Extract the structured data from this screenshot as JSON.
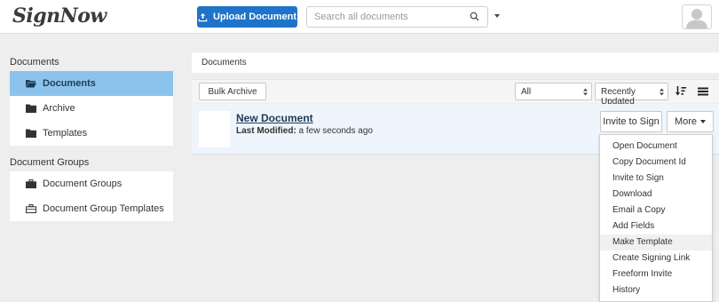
{
  "header": {
    "logo": "SignNow",
    "upload_label": "Upload Document",
    "search_placeholder": "Search all documents"
  },
  "sidebar": {
    "documents_title": "Documents",
    "documents_items": [
      {
        "label": "Documents",
        "icon": "open-folder-icon",
        "active": true
      },
      {
        "label": "Archive",
        "icon": "folder-icon"
      },
      {
        "label": "Templates",
        "icon": "folder-icon"
      }
    ],
    "groups_title": "Document Groups",
    "groups_items": [
      {
        "label": "Document Groups",
        "icon": "briefcase-icon"
      },
      {
        "label": "Document Group Templates",
        "icon": "briefcase-outline-icon"
      }
    ]
  },
  "main": {
    "breadcrumb": "Documents",
    "toolbar": {
      "bulk_archive": "Bulk Archive",
      "filter_value": "All",
      "sort_value": "Recently Updated"
    },
    "document": {
      "title": "New Document",
      "modified_label": "Last Modified:",
      "modified_value": " a few seconds ago",
      "invite_label": "Invite to Sign",
      "more_label": "More"
    },
    "more_menu": [
      "Open Document",
      "Copy Document Id",
      "Invite to Sign",
      "Download",
      "Email a Copy",
      "Add Fields",
      "Make Template",
      "Create Signing Link",
      "Freeform Invite",
      "History"
    ],
    "highlighted_menu_item": "Make Template"
  },
  "colors": {
    "primary": "#1f73c9",
    "sidebar_active": "#8cc3ec",
    "row_background": "#eef5fc"
  }
}
